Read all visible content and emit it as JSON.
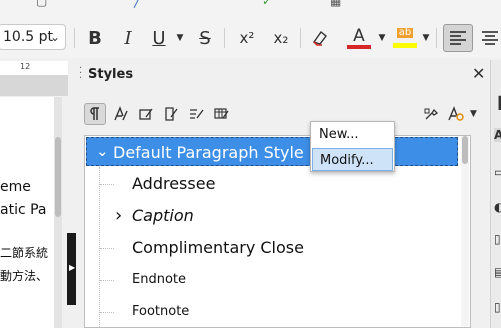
{
  "toolbar": {
    "font_size": "10.5 pt",
    "bold": "B",
    "italic": "I",
    "underline": "U",
    "strike": "S",
    "superscript": "x²",
    "subscript": "x₂",
    "font_color": "#d62828",
    "highlight_color": "#ffff00",
    "highlight_label": "ab"
  },
  "ruler": {
    "mark": "12"
  },
  "document": {
    "line1": "eme",
    "line2": "atic Pa",
    "line3": "二節系統",
    "line4": "動方法、"
  },
  "panel": {
    "title": "Styles",
    "close": "✕"
  },
  "styles": [
    {
      "label": "Default Paragraph Style",
      "selected": true,
      "expander": "⌄",
      "italic": false
    },
    {
      "label": "Addressee",
      "selected": false,
      "expander": "",
      "italic": false
    },
    {
      "label": "Caption",
      "selected": false,
      "expander": "›",
      "italic": true
    },
    {
      "label": "Complimentary Close",
      "selected": false,
      "expander": "",
      "italic": false
    },
    {
      "label": "Endnote",
      "selected": false,
      "expander": "",
      "italic": false
    },
    {
      "label": "Footnote",
      "selected": false,
      "expander": "",
      "italic": false
    }
  ],
  "context_menu": {
    "new_label": "New...",
    "modify_label": "Modify..."
  },
  "colors": {
    "selection": "#3d8ee6",
    "menu_hover": "#cfe3f8"
  }
}
